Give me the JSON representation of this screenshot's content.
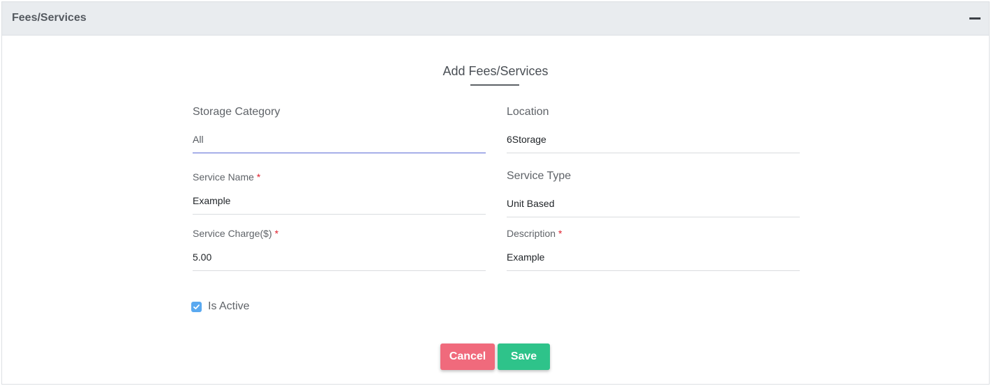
{
  "panel": {
    "title": "Fees/Services",
    "collapse_icon": "minus-icon"
  },
  "form": {
    "title": "Add Fees/Services",
    "storage_category": {
      "label": "Storage Category",
      "value": "All"
    },
    "location": {
      "label": "Location",
      "value": "6Storage"
    },
    "service_name": {
      "label": "Service Name",
      "required_mark": "*",
      "value": "Example"
    },
    "service_type": {
      "label": "Service Type",
      "value": "Unit Based"
    },
    "service_charge": {
      "label": "Service Charge($)",
      "required_mark": "*",
      "value": "5.00"
    },
    "description": {
      "label": "Description",
      "required_mark": "*",
      "value": "Example"
    },
    "is_active": {
      "label": "Is Active",
      "checked": true
    }
  },
  "buttons": {
    "cancel": "Cancel",
    "save": "Save"
  },
  "colors": {
    "cancel": "#f06a7c",
    "save": "#2ec38a",
    "checkbox": "#5aa9f0",
    "focus_line": "#5a69d6",
    "required": "#e0202e"
  }
}
